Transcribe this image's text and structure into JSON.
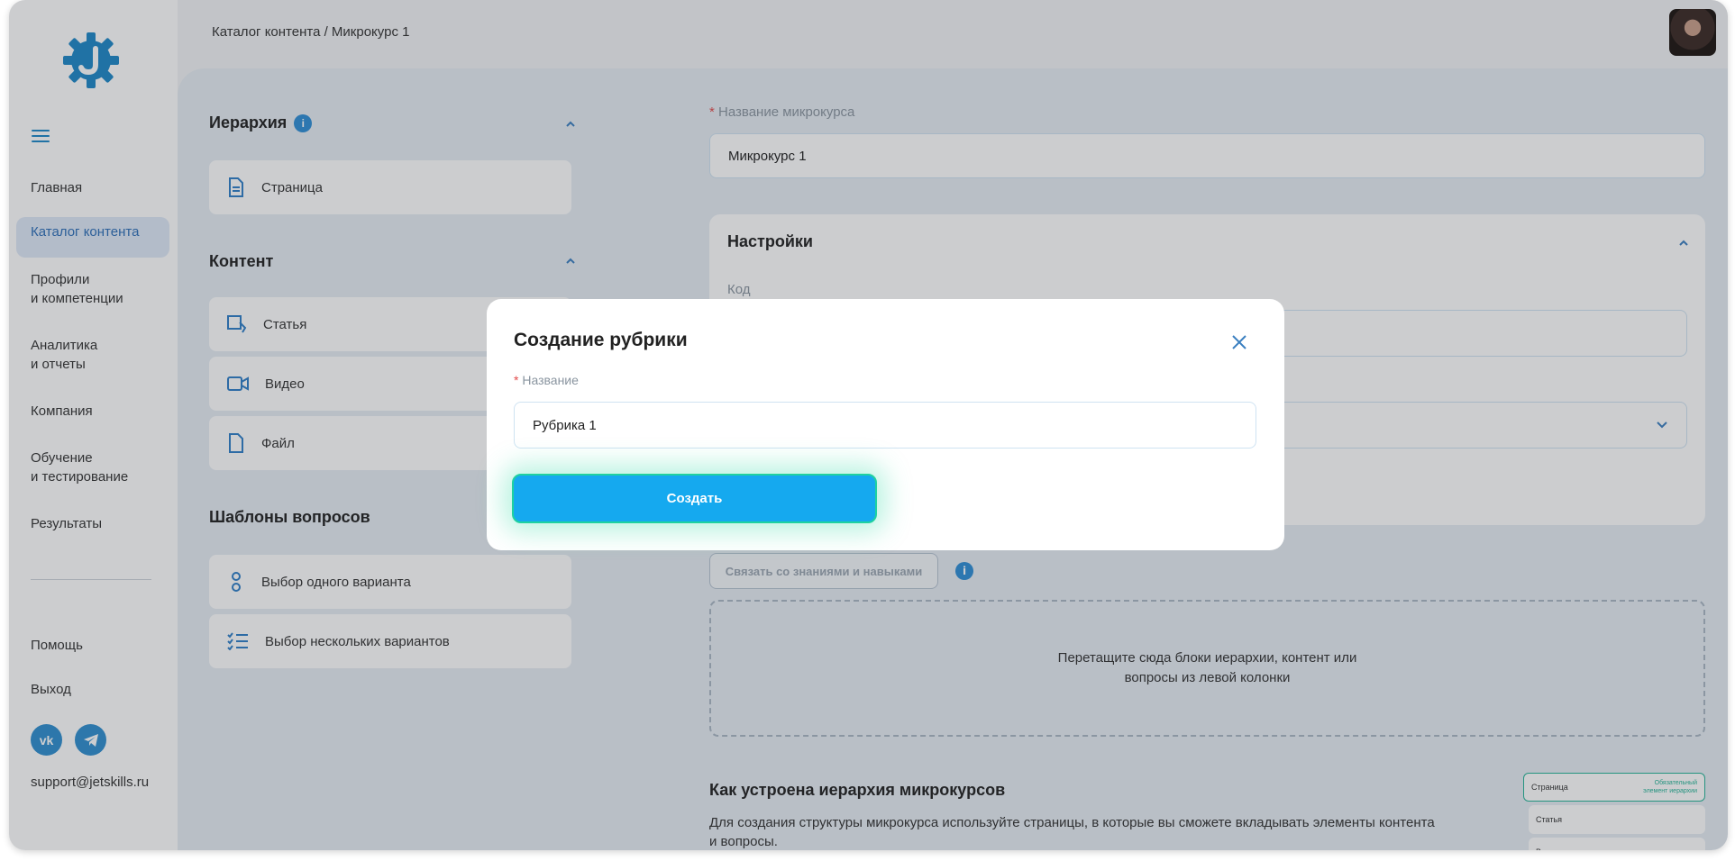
{
  "breadcrumb": "Каталог контента / Микрокурс 1",
  "sidebar": {
    "items": [
      {
        "label": "Главная"
      },
      {
        "label": "Каталог контента"
      },
      {
        "label": "Профили\nи компетенции"
      },
      {
        "label": "Аналитика\nи отчеты"
      },
      {
        "label": "Компания"
      },
      {
        "label": "Обучение\nи тестирование"
      },
      {
        "label": "Результаты"
      }
    ],
    "help": "Помощь",
    "logout": "Выход",
    "support_email": "support@jetskills.ru",
    "social": [
      "vk",
      "telegram"
    ]
  },
  "left_panel": {
    "hierarchy_title": "Иерархия",
    "hierarchy_items": [
      "Страница"
    ],
    "content_title": "Контент",
    "content_items": [
      "Статья",
      "Видео",
      "Файл"
    ],
    "questions_title": "Шаблоны вопросов",
    "question_items": [
      "Выбор одного варианта",
      "Выбор нескольких вариантов"
    ]
  },
  "form": {
    "name_label": "Название микрокурса",
    "name_value": "Микрокурс 1",
    "settings_title": "Настройки",
    "code_label": "Код",
    "link_button": "Связать со знаниями и навыками",
    "dropzone_text": "Перетащите сюда блоки иерархии, контент или\nвопросы из левой колонки",
    "hier_title": "Как устроена иерархия микрокурсов",
    "hier_desc": "Для создания структуры микрокурса используйте страницы, в которые вы сможете вкладывать элементы контента\nи вопросы."
  },
  "mini_preview": {
    "page": "Страница",
    "badge": "Обязательный\nэлемент иерархии",
    "article": "Статья",
    "video": "Видео"
  },
  "modal": {
    "title": "Создание рубрики",
    "name_label": "Название",
    "name_value": "Рубрика 1",
    "create_button": "Создать"
  },
  "colors": {
    "accent": "#15a9ef",
    "brand": "#1e88c8",
    "success": "#26b497"
  }
}
